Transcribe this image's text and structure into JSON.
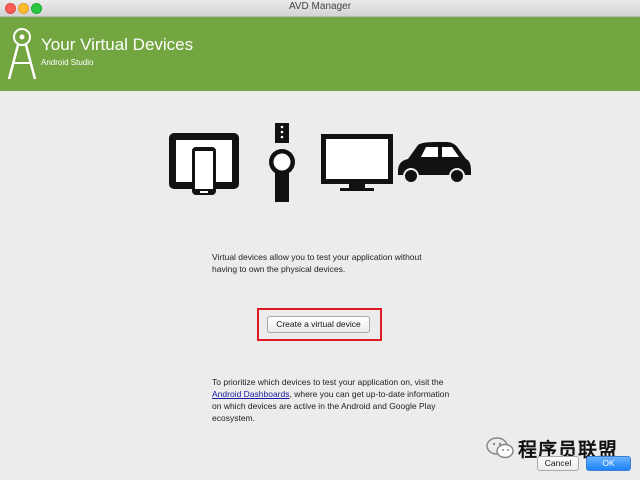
{
  "window": {
    "title": "AVD Manager"
  },
  "header": {
    "title": "Your Virtual Devices",
    "subtitle": "Android Studio",
    "background": "#73a540"
  },
  "devices": {
    "icons": [
      "tablet-phone-icon",
      "watch-icon",
      "tv-icon",
      "car-icon"
    ]
  },
  "intro": {
    "text": "Virtual devices allow you to test your application without having to own the physical devices."
  },
  "create_button": {
    "label": "Create a virtual device"
  },
  "info": {
    "prefix": "To prioritize which devices to test your application on, visit the ",
    "link": "Android Dashboards",
    "suffix": ", where you can get up-to-date information on which devices are active in the Android and Google Play ecosystem."
  },
  "watermark": {
    "text": "程序员联盟"
  },
  "footer": {
    "cancel_label": "Cancel",
    "ok_label": "OK"
  },
  "colors": {
    "accent": "#73a540",
    "highlight": "#e0181f",
    "ok": "#1a82fb"
  }
}
